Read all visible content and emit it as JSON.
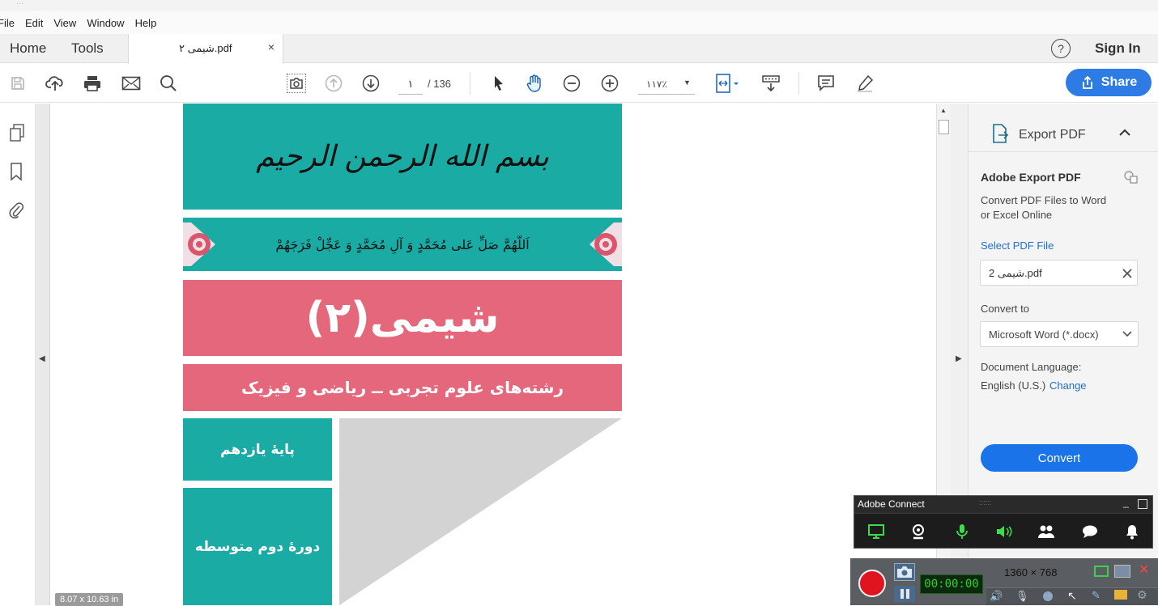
{
  "app": {
    "title_fragment": "...",
    "menu": [
      "File",
      "Edit",
      "View",
      "Window",
      "Help"
    ],
    "nav_tabs": {
      "home": "Home",
      "tools": "Tools"
    },
    "doc_tab": {
      "label": "شیمی ۲.pdf",
      "close": "×"
    },
    "help": "?",
    "sign_in": "Sign In"
  },
  "toolbar": {
    "page_current": "۱",
    "page_total": "/ 136",
    "zoom": "۱۱۷٪",
    "share_label": "Share"
  },
  "document": {
    "basmala": "بسم الله الرحمن الرحیم",
    "salawat": "اَللّهُمَّ صَلِّ عَلی مُحَمَّدٍ وَ آلِ مُحَمَّدٍ وَ عَجِّلْ فَرَجَهُمْ",
    "title": "شیمی(۲)",
    "subtitle": "رشته‌های علوم تجربی ــ ریاضی و فیزیک",
    "grade": "پایهٔ یازدهم",
    "level": "دورهٔ دوم متوسطه",
    "page_size": "8.07 x 10.63 in",
    "colors": {
      "teal": "#1aaba5",
      "pink": "#e5677c",
      "gray": "#d3d3d3"
    }
  },
  "export_panel": {
    "header": "Export PDF",
    "section_title": "Adobe Export PDF",
    "description_1": "Convert PDF Files to Word",
    "description_2": "or Excel Online",
    "select_file": "Select PDF File",
    "file_name": "شیمی 2.pdf",
    "convert_to_label": "Convert to",
    "format_value": "Microsoft Word (*.docx)",
    "doc_language_label": "Document Language:",
    "doc_language_value": "English (U.S.)",
    "change_link": "Change",
    "convert_button": "Convert"
  },
  "connect": {
    "title": "Adobe Connect",
    "handle": "::::::",
    "minimize": "_",
    "icons": [
      "screen-share-icon",
      "webcam-icon",
      "microphone-icon",
      "speaker-icon",
      "attendees-icon",
      "chat-icon",
      "notifications-icon"
    ],
    "color_green": "#3ddc4a"
  },
  "recorder": {
    "resolution": "1360 × 768",
    "timer": "00:00:00",
    "record_color": "#e0141e"
  }
}
